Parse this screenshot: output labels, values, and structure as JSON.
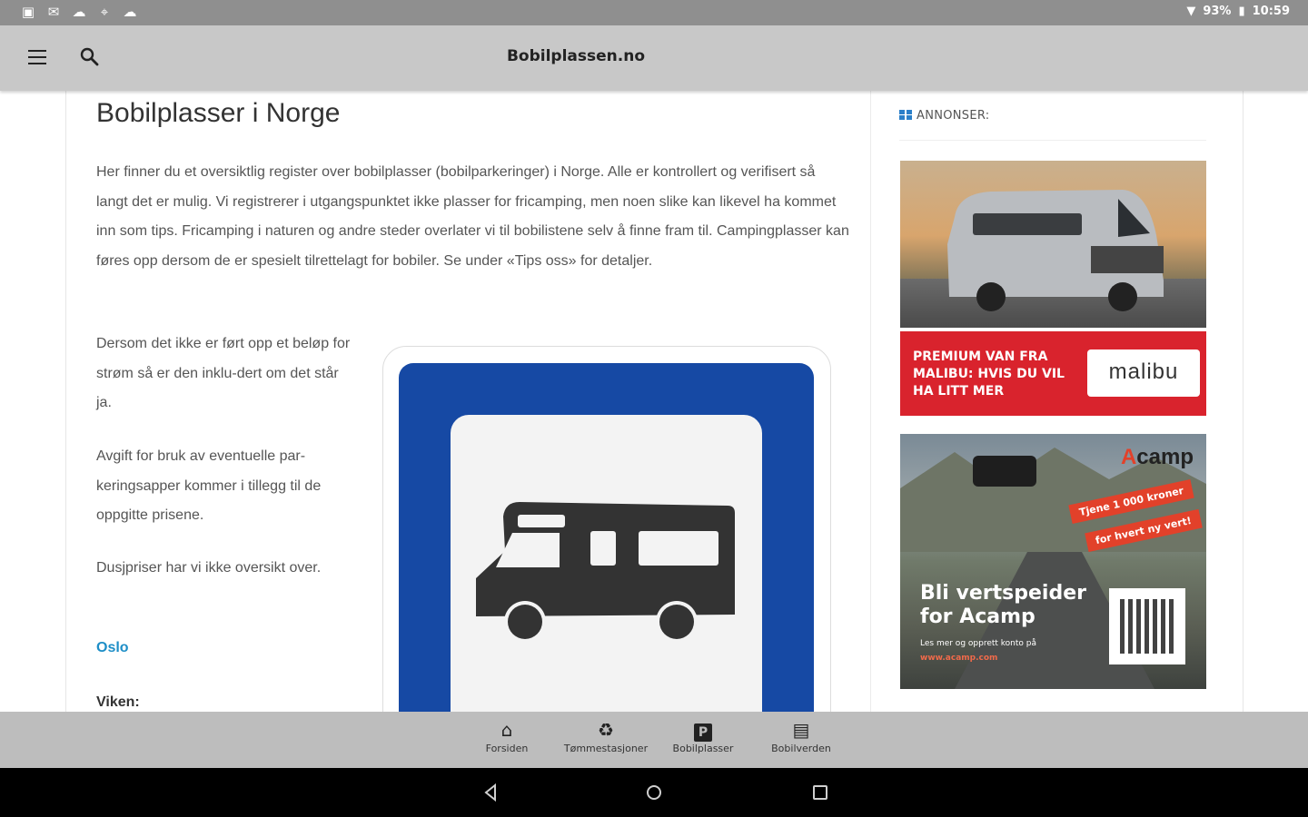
{
  "status_bar": {
    "battery": "93%",
    "time": "10:59",
    "left_icons": [
      "image-icon",
      "mail-icon",
      "cloud-icon",
      "location-icon",
      "cloud-icon"
    ]
  },
  "app_bar": {
    "title": "Bobilplassen.no",
    "menu_icon": "menu-icon",
    "search_icon": "search-icon"
  },
  "main": {
    "page_title": "Bobilplasser i Norge",
    "intro": "Her finner du et oversiktlig register over bobilplasser (bobilparkeringer) i Norge. Alle er kontrollert og verifisert så langt det er mulig. Vi registrerer i utgangspunktet ikke plasser for fricamping, men noen slike kan likevel ha kommet inn som tips. Fricamping i naturen og andre steder overlater vi til bobilistene selv å finne fram til. Campingplasser kan føres opp dersom de er spesielt tilrettelagt for bobiler. Se under «Tips oss» for detaljer.",
    "paragraphs": [
      "Dersom det ikke er ført opp et beløp for strøm så er den inklu-dert om det står ja.",
      "Avgift for bruk av eventuelle par-keringsapper kommer i tillegg til de oppgitte prisene.",
      "Dusjpriser har vi ikke oversikt over."
    ],
    "region_link": "Oslo",
    "region_label": "Viken:",
    "sign_image": "motorhome-sign"
  },
  "sidebar": {
    "ads_heading": "ANNONSER:",
    "ad1": {
      "text": "PREMIUM VAN FRA MALIBU: HVIS DU VIL HA LITT MER",
      "logo": "malibu",
      "colors": {
        "band": "#d9232d"
      }
    },
    "ad2": {
      "brand_mark": "A",
      "brand_rest": "camp",
      "ribbon1": "Tjene 1 000 kroner",
      "ribbon2": "for hvert ny vert!",
      "headline": "Bli vertspeider for Acamp",
      "sub": "Les mer og opprett konto på",
      "url": "www.acamp.com"
    }
  },
  "bottom_nav": {
    "items": [
      {
        "label": "Forsiden",
        "icon": "home-icon"
      },
      {
        "label": "Tømmestasjoner",
        "icon": "recycle-icon"
      },
      {
        "label": "Bobilplasser",
        "icon": "parking-icon"
      },
      {
        "label": "Bobilverden",
        "icon": "newspaper-icon"
      }
    ]
  },
  "system_nav": {
    "buttons": [
      "back-icon",
      "home-circle-icon",
      "recents-icon"
    ]
  },
  "colors": {
    "link": "#1e8ec7",
    "sign_blue": "#1649a4",
    "accent_red": "#d9232d"
  }
}
